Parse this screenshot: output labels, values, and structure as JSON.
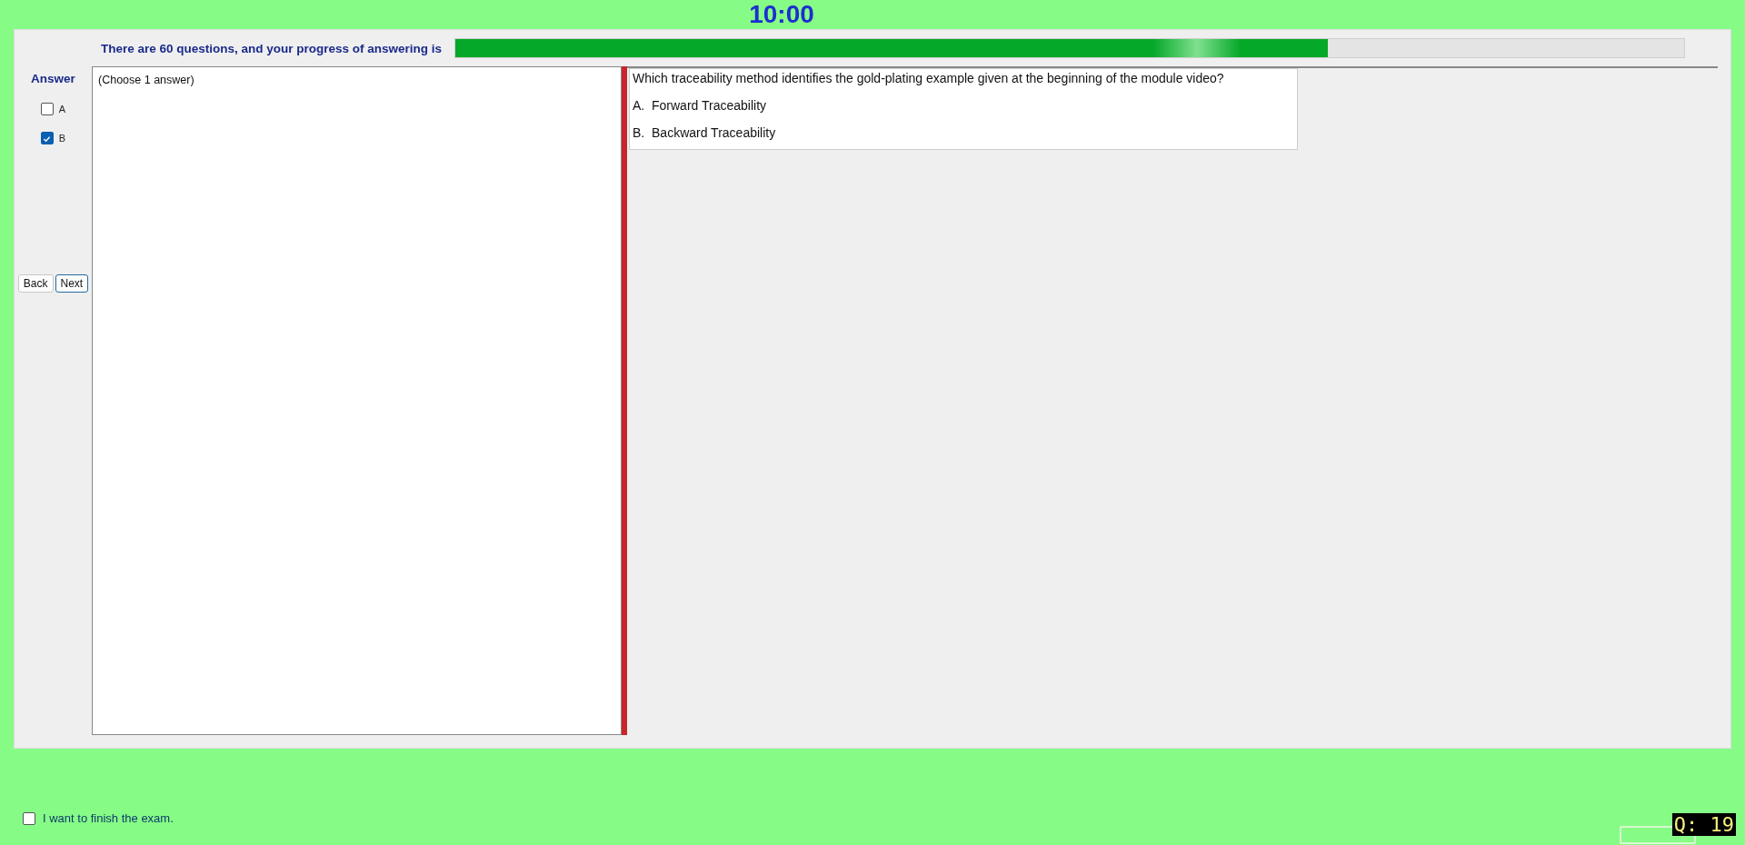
{
  "timer": "10:00",
  "progress": {
    "label": "There are 60 questions, and your progress of answering is",
    "level": 0.71
  },
  "answer_panel": {
    "title": "Answer",
    "options": [
      {
        "label": "A",
        "checked": false
      },
      {
        "label": "B",
        "checked": true
      }
    ]
  },
  "nav_buttons": [
    {
      "label": "Back",
      "selected": false
    },
    {
      "label": "Next",
      "selected": true
    }
  ],
  "answer_hint": "(Choose 1 answer)",
  "question": {
    "text": "Which traceability method identifies the gold-plating example given at the beginning of the module video?",
    "choices": [
      {
        "letter": "A.",
        "text": "Forward Traceability"
      },
      {
        "letter": "B.",
        "text": "Backward Traceability"
      }
    ]
  },
  "finish": {
    "label": "I want to finish the exam.",
    "checked": false
  },
  "question_number": "Q: 19"
}
